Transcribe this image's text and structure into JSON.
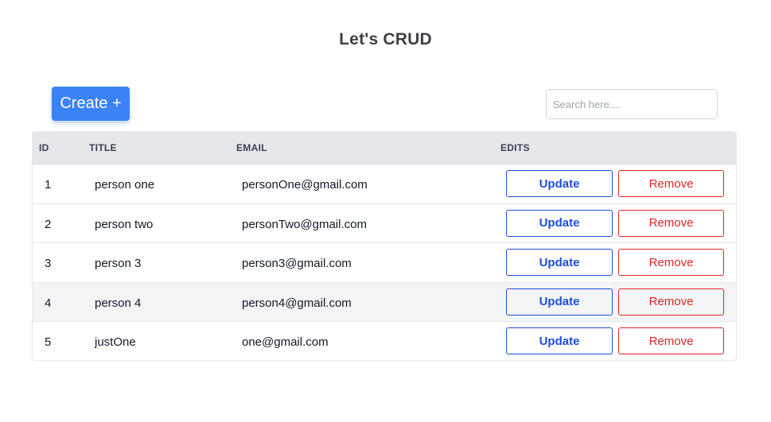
{
  "title": "Let's CRUD",
  "toolbar": {
    "create_label": "Create +",
    "search_placeholder": "Search here...."
  },
  "table": {
    "headers": {
      "id": "ID",
      "title": "TITLE",
      "email": "EMAIL",
      "edits": "EDITS"
    },
    "update_label": "Update",
    "remove_label": "Remove",
    "rows": [
      {
        "id": "1",
        "title": "person one",
        "email": "personOne@gmail.com"
      },
      {
        "id": "2",
        "title": "person two",
        "email": "personTwo@gmail.com"
      },
      {
        "id": "3",
        "title": "person 3",
        "email": "person3@gmail.com"
      },
      {
        "id": "4",
        "title": "person 4",
        "email": "person4@gmail.com"
      },
      {
        "id": "5",
        "title": "justOne",
        "email": "one@gmail.com"
      }
    ]
  },
  "colors": {
    "primary": "#3b82f6",
    "update": "#1d4ed8",
    "remove": "#dc2626",
    "header_bg": "#e5e7eb",
    "hover_row_bg": "#f3f4f6"
  }
}
